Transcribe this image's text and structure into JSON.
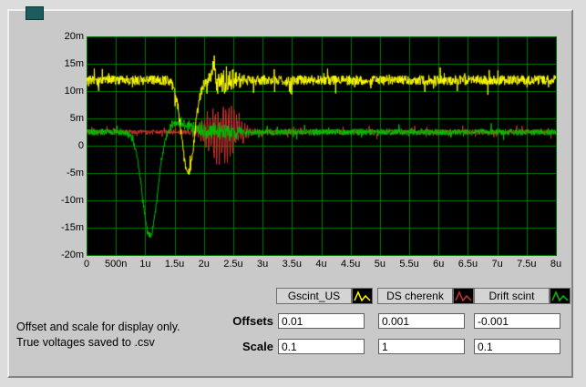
{
  "window": {
    "bg_color": "#dcdcdc",
    "panel_color": "#c9c9c9",
    "indicator_color": "#1d5c5c"
  },
  "note": {
    "line1": "Offset and scale for display only.",
    "line2": "True voltages saved to .csv"
  },
  "controls": {
    "offsets_label": "Offsets",
    "scale_label": "Scale",
    "offsets": [
      "0.01",
      "0.001",
      "-0.001"
    ],
    "scales": [
      "0.1",
      "1",
      "0.1"
    ]
  },
  "legend": [
    {
      "label": "Gscint_US",
      "color": "#ffff00"
    },
    {
      "label": "DS cherenk",
      "color": "#cc3333"
    },
    {
      "label": "Drift scint",
      "color": "#00c000"
    }
  ],
  "chart_data": {
    "type": "line",
    "title": "",
    "xlabel": "",
    "ylabel": "",
    "x_ticks": [
      "0",
      "500n",
      "1u",
      "1.5u",
      "2u",
      "2.5u",
      "3u",
      "3.5u",
      "4u",
      "4.5u",
      "5u",
      "5.5u",
      "6u",
      "6.5u",
      "7u",
      "7.5u",
      "8u"
    ],
    "y_ticks": [
      "20m",
      "15m",
      "10m",
      "5m",
      "0",
      "-5m",
      "-10m",
      "-15m",
      "-20m"
    ],
    "xlim_us": [
      0,
      8
    ],
    "ylim_mv": [
      -20,
      20
    ],
    "grid": true,
    "grid_color": "#007a00",
    "plot_bg": "#000000",
    "draw_order": [
      1,
      2,
      0
    ],
    "series": [
      {
        "name": "Gscint_US",
        "color": "#ffff00",
        "seed": 7,
        "baseline_mv": 12,
        "noise_mv": 0.9,
        "events": [
          {
            "type": "gauss",
            "center_us": 1.73,
            "sigma_us": 0.11,
            "amp_mv": -17
          },
          {
            "type": "spike",
            "center_us": 2.16,
            "width_us": 0.05,
            "amp_mv": 3.8
          },
          {
            "type": "noisy",
            "center_us": 2.35,
            "sigma_us": 0.18,
            "amp_mv": 2.5
          }
        ]
      },
      {
        "name": "DS cherenk",
        "color": "#cc3333",
        "seed": 13,
        "baseline_mv": 2.5,
        "noise_mv": 0.45,
        "events": [
          {
            "type": "osc",
            "center_us": 2.32,
            "sigma_us": 0.22,
            "amp_mv": 4.5,
            "freq_per_us": 22
          },
          {
            "type": "noisy",
            "center_us": 2.35,
            "sigma_us": 0.3,
            "amp_mv": 1.5
          }
        ]
      },
      {
        "name": "Drift scint",
        "color": "#00c000",
        "seed": 21,
        "baseline_mv": 2.5,
        "noise_mv": 0.6,
        "events": [
          {
            "type": "gauss",
            "center_us": 1.08,
            "sigma_us": 0.13,
            "amp_mv": -19
          },
          {
            "type": "gauss",
            "center_us": 1.55,
            "sigma_us": 0.2,
            "amp_mv": 1.5
          },
          {
            "type": "noisy",
            "center_us": 2.15,
            "sigma_us": 0.35,
            "amp_mv": 1.5
          }
        ]
      }
    ]
  }
}
